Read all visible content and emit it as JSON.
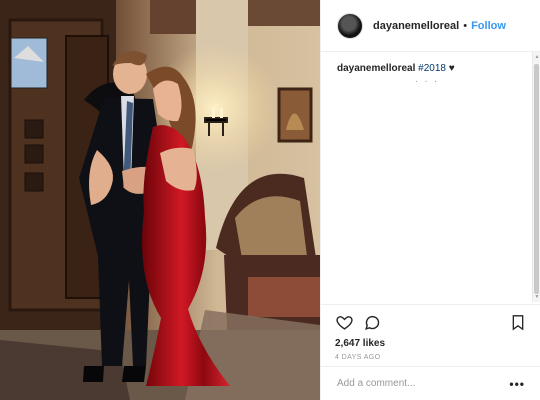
{
  "post": {
    "username": "dayanemelloreal",
    "separator": "•",
    "follow_label": "Follow",
    "caption": {
      "username": "dayanemelloreal",
      "hashtag": "#2018",
      "suffix": "♥"
    },
    "more_indicator": ". . .",
    "likes": "2,647 likes",
    "timestamp": "4 DAYS AGO",
    "comment_placeholder": "Add a comment...",
    "options_label": "•••"
  },
  "photo": {
    "alt": "Man in a dark suit and woman in a red satin gown embracing indoors"
  },
  "icons": {
    "like": "heart-icon",
    "comment": "comment-icon",
    "save": "bookmark-icon"
  },
  "colors": {
    "accent": "#3897f0",
    "text": "#262626",
    "muted": "#999999",
    "dress": "#c0141f"
  }
}
